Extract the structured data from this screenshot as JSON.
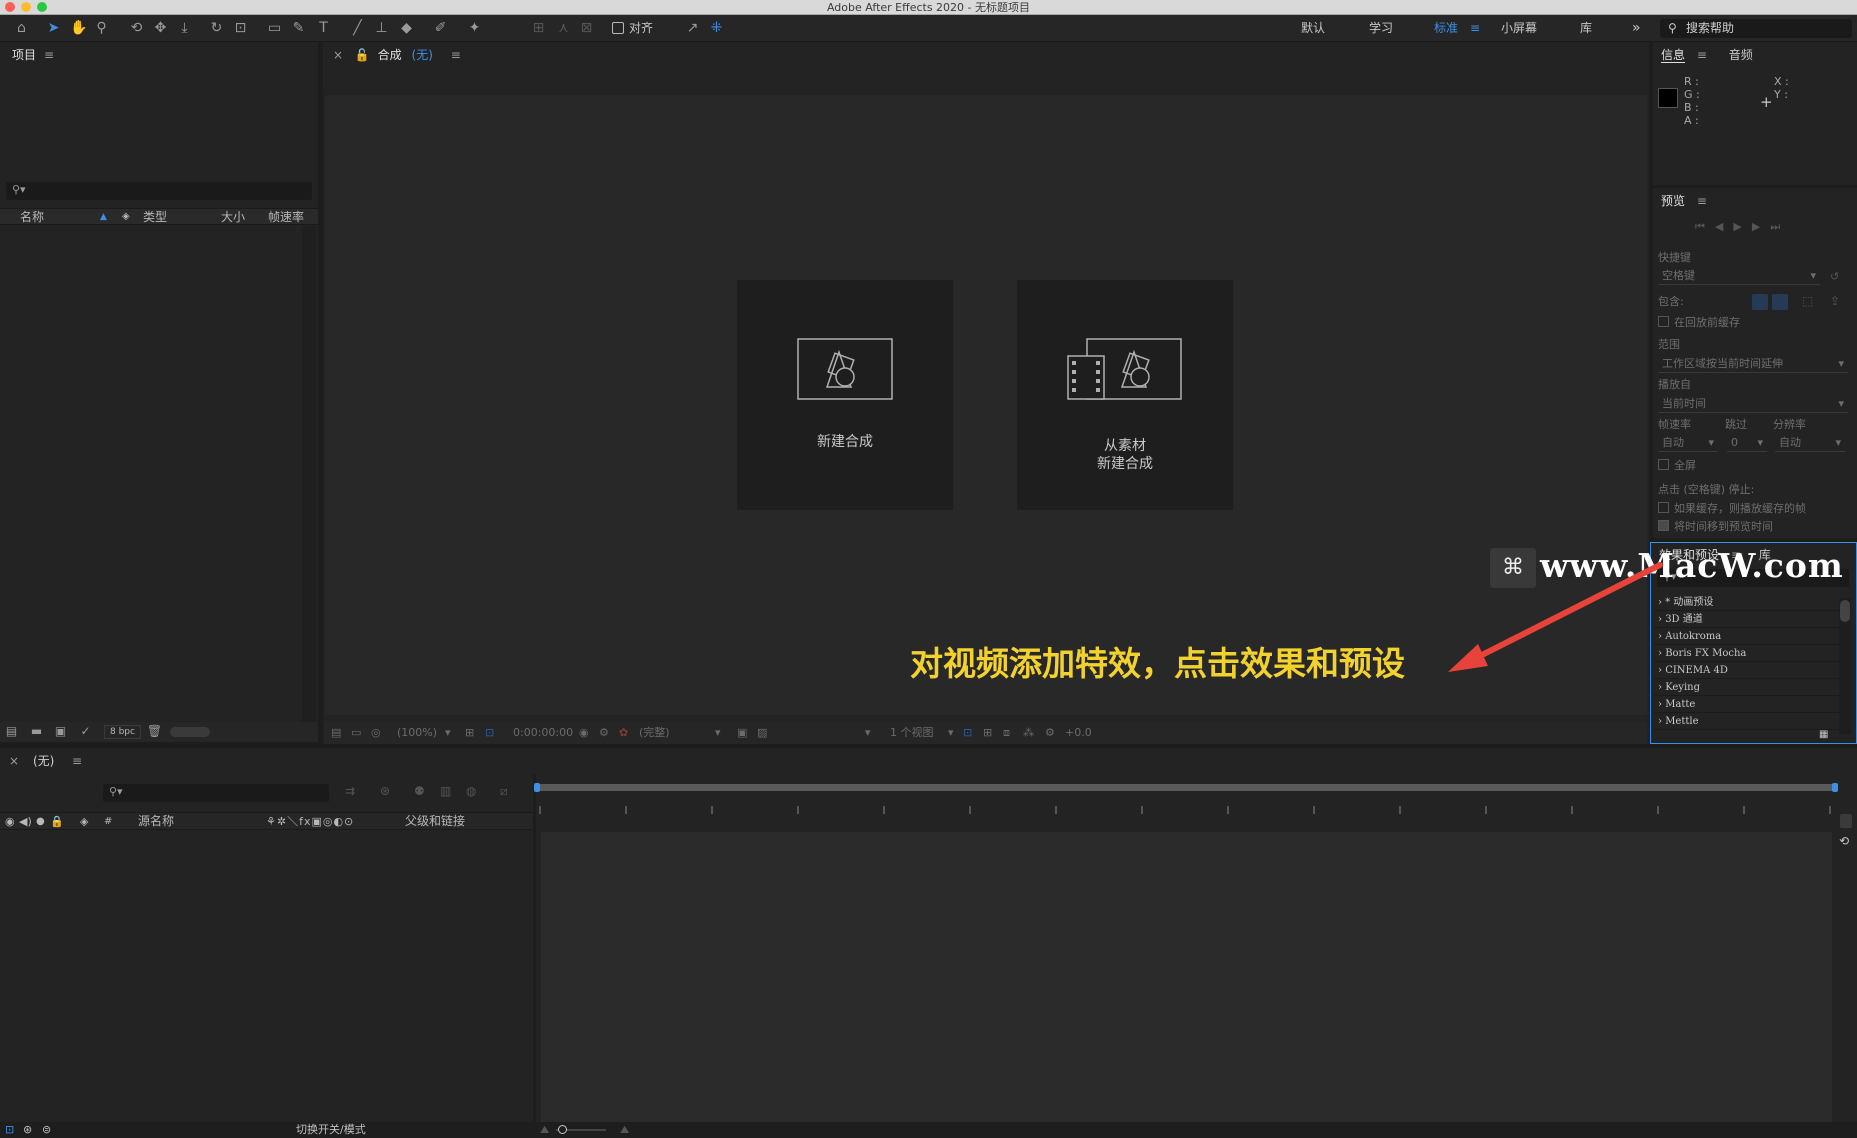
{
  "window": {
    "title": "Adobe After Effects 2020 - 无标题项目",
    "traffic_colors": {
      "close": "#ff5f57",
      "minimize": "#febc2e",
      "zoom": "#28c840"
    }
  },
  "toolbar": {
    "align_label": "对齐",
    "workspaces": [
      "默认",
      "学习",
      "标准",
      "小屏幕",
      "库"
    ],
    "active_workspace": "标准",
    "more_glyph": "»",
    "help_label": "搜索帮助",
    "accent": "#3d8fe8"
  },
  "project_panel": {
    "title": "项目",
    "columns": [
      "名称",
      "类型",
      "大小",
      "帧速率"
    ],
    "bpc_label": "8 bpc"
  },
  "comp_panel": {
    "tab_label": "合成",
    "tab_value": "(无)",
    "new_comp_label": "新建合成",
    "from_footage_line1": "从素材",
    "from_footage_line2": "新建合成",
    "footer": {
      "zoom": "(100%)",
      "timecode": "0:00:00:00",
      "resolution": "(完整)",
      "views": "1 个视图",
      "exposure": "+0.0"
    }
  },
  "info_panel": {
    "tabs": [
      "信息",
      "音频"
    ],
    "labels": [
      "R :",
      "G :",
      "B :",
      "A :"
    ],
    "xy_labels": [
      "X :",
      "Y :"
    ]
  },
  "preview_panel": {
    "title": "预览",
    "shortcut_label": "快捷键",
    "shortcut_value": "空格键",
    "include_label": "包含:",
    "cache_label": "在回放前缓存",
    "range_label": "范围",
    "range_value": "工作区域按当前时间延伸",
    "play_from_label": "播放自",
    "play_from_value": "当前时间",
    "fps_label": "帧速率",
    "skip_label": "跳过",
    "resolution_label": "分辨率",
    "fps_value": "自动",
    "skip_value": "0",
    "resolution_value": "自动",
    "fullscreen_label": "全屏",
    "stop_label": "点击 (空格键) 停止:",
    "stop_opt1": "如果缓存，则播放缓存的帧",
    "stop_opt2": "将时间移到预览时间"
  },
  "effects_panel": {
    "tabs": [
      "效果和预设",
      "库"
    ],
    "items": [
      "* 动画预设",
      "3D 通道",
      "Autokroma",
      "Boris FX Mocha",
      "CINEMA 4D",
      "Keying",
      "Matte",
      "Mettle"
    ]
  },
  "timeline": {
    "tab_value": "(无)",
    "col_source": "源名称",
    "col_parent": "父级和链接",
    "toggle_label": "切换开关/模式"
  },
  "overlay": {
    "watermark": "www.MacW.com",
    "annotation": "对视频添加特效，点击效果和预设",
    "annotation_color": "#f3d22e",
    "arrow_color": "#e8433a"
  }
}
